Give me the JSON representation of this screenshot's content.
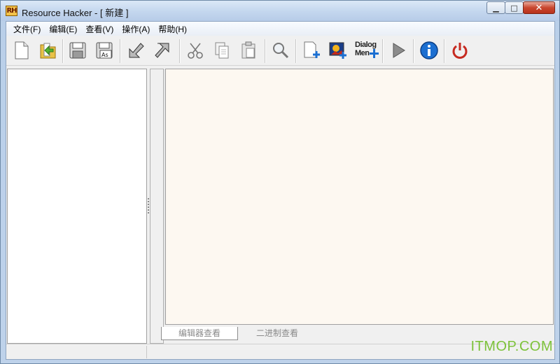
{
  "window": {
    "logo_text": "RH",
    "title": "Resource Hacker - [ 新建 ]",
    "minimize_symbol": "▁",
    "maximize_symbol": "□",
    "close_symbol": "✕"
  },
  "menu": [
    {
      "label": "文件(F)"
    },
    {
      "label": "编辑(E)"
    },
    {
      "label": "查看(V)"
    },
    {
      "label": "操作(A)"
    },
    {
      "label": "帮助(H)"
    }
  ],
  "toolbar": {
    "buttons": [
      {
        "name": "new-file",
        "icon": "new-file-icon"
      },
      {
        "name": "open",
        "icon": "open-folder-icon"
      },
      {
        "name": "save",
        "icon": "save-icon"
      },
      {
        "name": "save-as",
        "icon": "save-as-icon",
        "text": "As"
      },
      {
        "name": "compile",
        "icon": "compile-arrow-icon"
      },
      {
        "name": "decompile",
        "icon": "decompile-arrow-icon"
      },
      {
        "name": "cut",
        "icon": "scissors-icon"
      },
      {
        "name": "copy",
        "icon": "copy-icon"
      },
      {
        "name": "paste",
        "icon": "paste-icon"
      },
      {
        "name": "find",
        "icon": "magnifier-icon"
      },
      {
        "name": "add-blank-resource",
        "icon": "add-resource-icon"
      },
      {
        "name": "add-image-resource",
        "icon": "add-image-icon"
      },
      {
        "name": "dialog-menu",
        "icon": "dialog-menu-icon",
        "text": "Dialog\nMen"
      },
      {
        "name": "run-script",
        "icon": "play-icon"
      },
      {
        "name": "about",
        "icon": "info-icon"
      },
      {
        "name": "exit",
        "icon": "power-icon"
      }
    ],
    "dialog_label_line1": "Dialog",
    "dialog_label_line2": "Men",
    "save_as_text": "As"
  },
  "editor": {
    "tabs": [
      {
        "label": "编辑器查看",
        "active": true
      },
      {
        "label": "二进制查看",
        "active": false
      }
    ],
    "background": "#fdf8f1"
  },
  "watermark": "ITMOP.COM",
  "colors": {
    "accent_blue": "#1c6fd1",
    "power_red": "#c62a20",
    "watermark_green": "#7dc23a"
  }
}
